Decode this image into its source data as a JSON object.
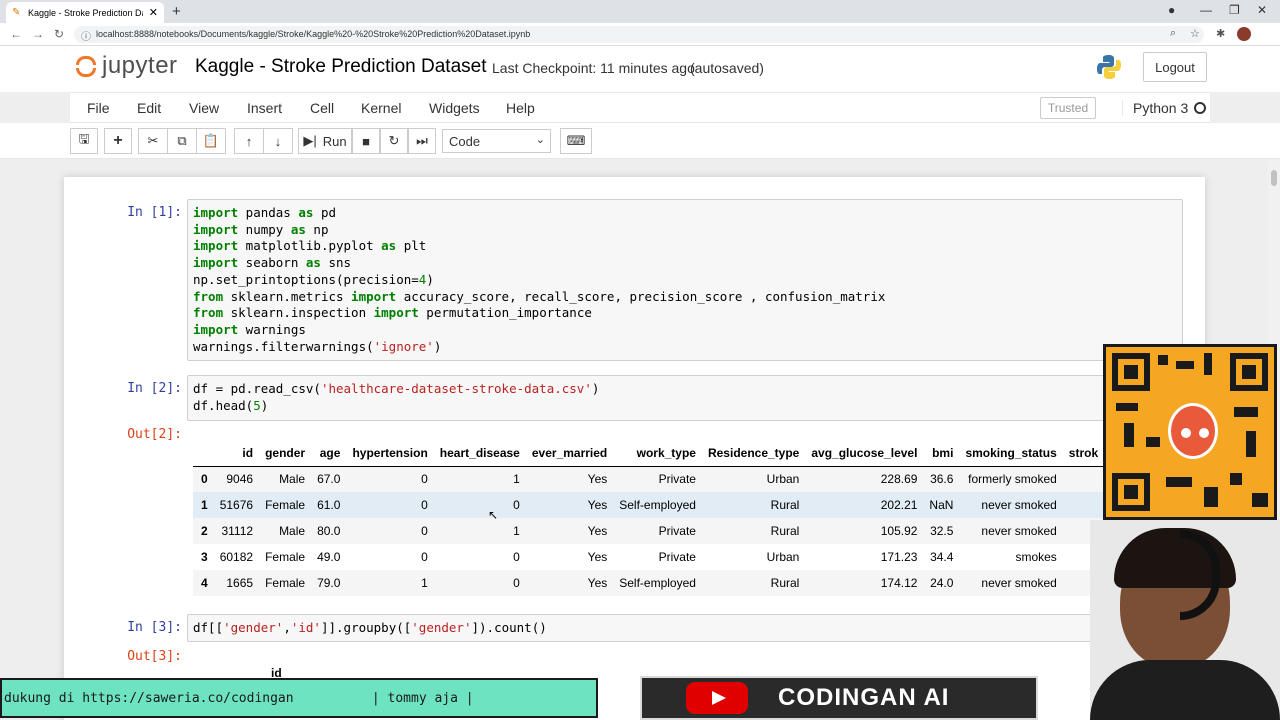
{
  "browser": {
    "tab_title": "Kaggle - Stroke Prediction Datas",
    "url": "localhost:8888/notebooks/Documents/kaggle/Stroke/Kaggle%20-%20Stroke%20Prediction%20Dataset.ipynb"
  },
  "header": {
    "logo_text": "jupyter",
    "notebook_title": "Kaggle - Stroke Prediction Dataset",
    "checkpoint": "Last Checkpoint: 11 minutes ago",
    "autosave": "(autosaved)",
    "logout_label": "Logout"
  },
  "menubar": {
    "items": [
      "File",
      "Edit",
      "View",
      "Insert",
      "Cell",
      "Kernel",
      "Widgets",
      "Help"
    ],
    "trusted": "Trusted",
    "kernel": "Python 3"
  },
  "toolbar": {
    "run_label": "Run",
    "cell_type": "Code"
  },
  "cells": {
    "in1_prompt": "In [1]:",
    "in2_prompt": "In [2]:",
    "out2_prompt": "Out[2]:",
    "in3_prompt": "In [3]:",
    "out3_prompt": "Out[3]:",
    "out3_partial": "id",
    "cell1_lines": [
      "import pandas as pd",
      "import numpy as np",
      "import matplotlib.pyplot as plt",
      "import seaborn as sns",
      "np.set_printoptions(precision=4)",
      "from sklearn.metrics import accuracy_score, recall_score, precision_score , confusion_matrix",
      "from sklearn.inspection import permutation_importance",
      "import warnings",
      "warnings.filterwarnings('ignore')"
    ],
    "cell2_lines": [
      "df = pd.read_csv('healthcare-dataset-stroke-data.csv')",
      "df.head(5)"
    ],
    "cell3_lines": [
      "df[['gender','id']].groupby(['gender']).count()"
    ]
  },
  "dataframe": {
    "columns": [
      "",
      "id",
      "gender",
      "age",
      "hypertension",
      "heart_disease",
      "ever_married",
      "work_type",
      "Residence_type",
      "avg_glucose_level",
      "bmi",
      "smoking_status",
      "strok"
    ],
    "rows": [
      [
        "0",
        "9046",
        "Male",
        "67.0",
        "0",
        "1",
        "Yes",
        "Private",
        "Urban",
        "228.69",
        "36.6",
        "formerly smoked",
        ""
      ],
      [
        "1",
        "51676",
        "Female",
        "61.0",
        "0",
        "0",
        "Yes",
        "Self-employed",
        "Rural",
        "202.21",
        "NaN",
        "never smoked",
        ""
      ],
      [
        "2",
        "31112",
        "Male",
        "80.0",
        "0",
        "1",
        "Yes",
        "Private",
        "Rural",
        "105.92",
        "32.5",
        "never smoked",
        ""
      ],
      [
        "3",
        "60182",
        "Female",
        "49.0",
        "0",
        "0",
        "Yes",
        "Private",
        "Urban",
        "171.23",
        "34.4",
        "smokes",
        ""
      ],
      [
        "4",
        "1665",
        "Female",
        "79.0",
        "1",
        "0",
        "Yes",
        "Self-employed",
        "Rural",
        "174.12",
        "24.0",
        "never smoked",
        ""
      ]
    ]
  },
  "overlay": {
    "ticker_text": "dukung di https://saweria.co/codingan          | tommy aja |",
    "channel_name": "CODINGAN AI"
  },
  "icons": {
    "save": "floppy-icon",
    "add": "plus-icon",
    "cut": "scissors-icon",
    "copy": "copy-icon",
    "paste": "paste-icon",
    "up": "arrow-up-icon",
    "down": "arrow-down-icon",
    "stop": "stop-icon",
    "restart": "restart-icon",
    "fast_forward": "fast-forward-icon",
    "keyboard": "keyboard-icon"
  }
}
